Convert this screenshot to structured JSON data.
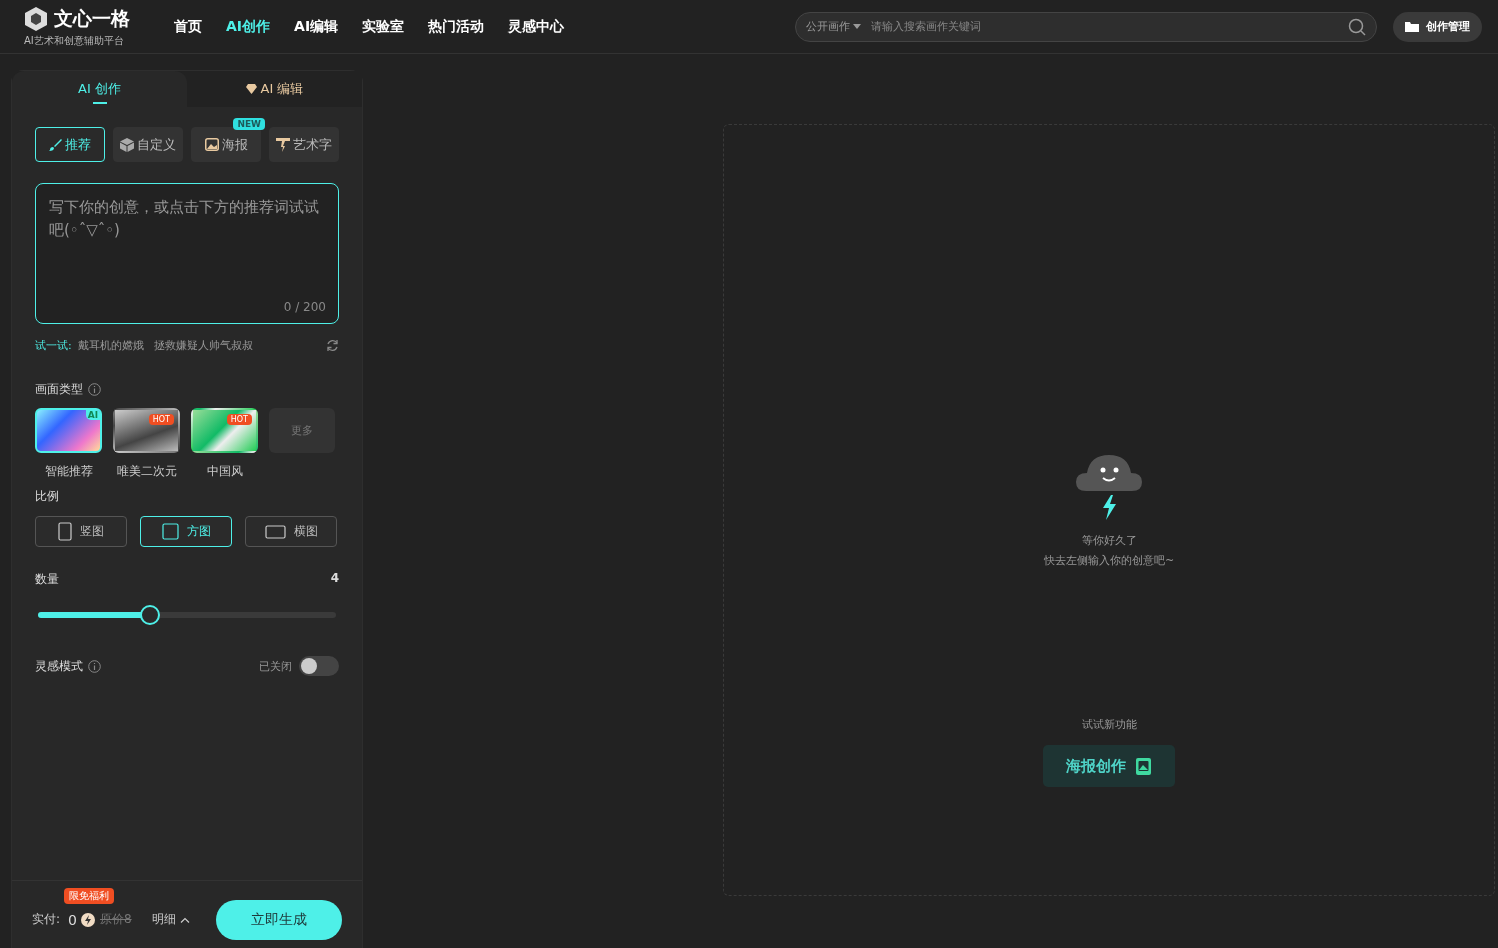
{
  "header": {
    "logo": {
      "name": "文心一格",
      "tagline": "AI艺术和创意辅助平台"
    },
    "nav": [
      {
        "label": "首页",
        "selected": false
      },
      {
        "label": "AI创作",
        "selected": true
      },
      {
        "label": "AI编辑",
        "selected": false
      },
      {
        "label": "实验室",
        "selected": false
      },
      {
        "label": "热门活动",
        "selected": false
      },
      {
        "label": "灵感中心",
        "selected": false
      }
    ],
    "search": {
      "scope": "公开画作",
      "placeholder": "请输入搜索画作关键词"
    },
    "manage_button": "创作管理"
  },
  "panel": {
    "tabs": [
      {
        "label": "AI 创作",
        "selected": true,
        "kind": "plain"
      },
      {
        "label": "AI 编辑",
        "selected": false,
        "kind": "gem"
      }
    ],
    "modes": [
      {
        "label": "推荐",
        "selected": true,
        "kind": "brush"
      },
      {
        "label": "自定义",
        "selected": false,
        "kind": "cube"
      },
      {
        "label": "海报",
        "selected": false,
        "kind": "image",
        "badge": "NEW"
      },
      {
        "label": "艺术字",
        "selected": false,
        "kind": "letter"
      }
    ],
    "prompt": {
      "placeholder": "写下你的创意，或点击下方的推荐词试试吧(◦ˆ▽ˆ◦)",
      "counter": "0 / 200"
    },
    "try": {
      "label": "试一试:",
      "suggestions": [
        "戴耳机的嫦娥",
        "拯救嫌疑人帅气叔叔"
      ]
    },
    "style": {
      "title": "画面类型",
      "options": [
        {
          "label": "智能推荐",
          "selected": true,
          "kind": "gradient",
          "badge": "AI"
        },
        {
          "label": "唯美二次元",
          "selected": false,
          "kind": "photo",
          "badge": "HOT"
        },
        {
          "label": "中国风",
          "selected": false,
          "kind": "landscape",
          "badge": "HOT"
        }
      ],
      "more": "更多"
    },
    "ratio": {
      "title": "比例",
      "options": [
        {
          "label": "竖图",
          "selected": false,
          "kind": "portrait"
        },
        {
          "label": "方图",
          "selected": true,
          "kind": "square"
        },
        {
          "label": "横图",
          "selected": false,
          "kind": "landscape"
        }
      ]
    },
    "count": {
      "label": "数量",
      "value": "4",
      "level": 0.375
    },
    "inspiration": {
      "label": "灵感模式",
      "state_text": "已关闭",
      "on": false
    },
    "footer": {
      "pay_label": "实付:",
      "amount": "0",
      "original_price": "原价8",
      "promo": "限免福利",
      "detail": "明细",
      "generate": "立即生成"
    }
  },
  "canvas": {
    "lines": [
      "等你好久了",
      "快去左侧输入你的创意吧~"
    ],
    "try_label": "试试新功能",
    "feature_button": "海报创作"
  }
}
